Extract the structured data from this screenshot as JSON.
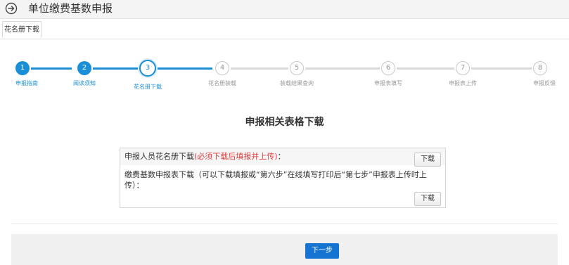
{
  "header": {
    "title": "单位缴费基数申报",
    "back_icon": "arrow-right-circle-icon"
  },
  "tabs": [
    {
      "label": "花名册下载"
    }
  ],
  "steps": [
    {
      "number": "1",
      "label": "申报指南"
    },
    {
      "number": "2",
      "label": "阅读须知"
    },
    {
      "number": "3",
      "label": "花名册下载"
    },
    {
      "number": "4",
      "label": "花名册装载"
    },
    {
      "number": "5",
      "label": "装载结果查询"
    },
    {
      "number": "6",
      "label": "申报表填写"
    },
    {
      "number": "7",
      "label": "申报表上传"
    },
    {
      "number": "8",
      "label": "申报反馈"
    }
  ],
  "current_step": 3,
  "colors": {
    "accent": "#1a8ed6",
    "warning": "#e23c3c",
    "primary_button": "#1574d1"
  },
  "main": {
    "section_title": "申报相关表格下载",
    "rows": [
      {
        "label": "申报人员花名册下载",
        "note": "(必须下载后填报并上传)",
        "suffix": "：",
        "button": "下载"
      },
      {
        "label": "缴费基数申报表下载（可以下载填报或“第六步”在线填写打印后“第七步”申报表上传时上传）：",
        "button": "下载"
      }
    ]
  },
  "footer": {
    "next_label": "下一步"
  }
}
